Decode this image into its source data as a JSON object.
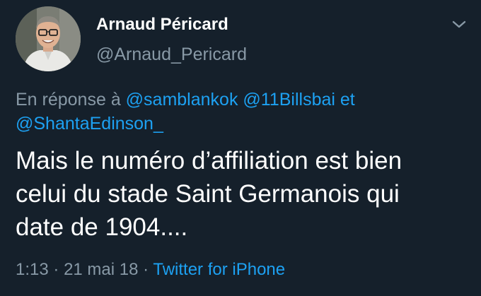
{
  "author": {
    "display_name": "Arnaud Péricard",
    "username": "@Arnaud_Pericard",
    "avatar_icon": "person-photo"
  },
  "menu_icon": "chevron-down-icon",
  "reply_context": {
    "prefix": "En réponse à",
    "mentions": [
      "@samblankok",
      "@11Billsbai",
      "@ShantaEdinson_"
    ],
    "conjunction": "et"
  },
  "tweet": {
    "text_lines": [
      "Mais le numéro d’affiliation est bien",
      "celui du stade Saint Germanois qui",
      "date de 1904...."
    ]
  },
  "meta": {
    "time": "1:13",
    "separator1": "·",
    "date": "21 mai 18",
    "separator2": "·",
    "source": "Twitter for iPhone"
  },
  "colors": {
    "background": "#15202b",
    "text": "#ffffff",
    "secondary": "#8899a6",
    "link": "#1da1f2"
  }
}
